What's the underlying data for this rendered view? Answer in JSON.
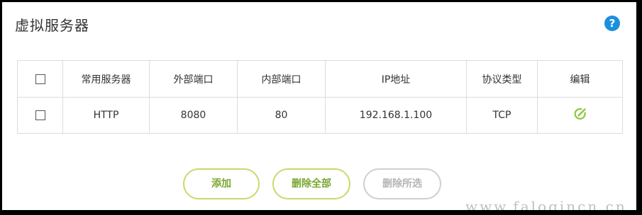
{
  "page": {
    "title": "虚拟服务器",
    "help_icon": "help-icon",
    "help_label": "?"
  },
  "table": {
    "headers": [
      "常用服务器",
      "外部端口",
      "内部端口",
      "IP地址",
      "协议类型",
      "编辑"
    ],
    "rows": [
      {
        "server": "HTTP",
        "external_port": "8080",
        "internal_port": "80",
        "ip": "192.168.1.100",
        "protocol": "TCP",
        "edit_icon": "edit-icon"
      }
    ]
  },
  "buttons": {
    "add": "添加",
    "delete_all": "删除全部",
    "delete_selected": "删除所选"
  },
  "colors": {
    "accent_green": "#79a72d",
    "button_border_green": "#c3dc6c",
    "help_blue": "#1b8fe0",
    "disabled_grey": "#b5b5b5"
  },
  "watermark": "www.falogincn.cn"
}
